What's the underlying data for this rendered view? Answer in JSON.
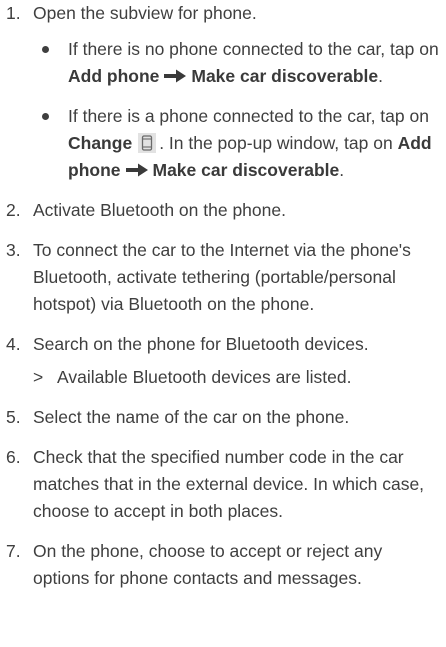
{
  "steps": [
    {
      "num": "1.",
      "text": "Open the subview for phone."
    },
    {
      "num": "2.",
      "text": "Activate Bluetooth on the phone."
    },
    {
      "num": "3.",
      "text": "To connect the car to the Internet via the phone's Bluetooth, activate tethering (portable/personal hotspot) via Bluetooth on the phone."
    },
    {
      "num": "4.",
      "text": "Search on the phone for Bluetooth devices.",
      "result_marker": ">",
      "result": "Available Bluetooth devices are listed."
    },
    {
      "num": "5.",
      "text": "Select the name of the car on the phone."
    },
    {
      "num": "6.",
      "text": "Check that the specified number code in the car matches that in the external device. In which case, choose to accept in both places."
    },
    {
      "num": "7.",
      "text": "On the phone, choose to accept or reject any options for phone contacts and messages."
    }
  ],
  "bullets": [
    {
      "pre": "If there is no phone connected to the car, tap on ",
      "bold1": "Add phone",
      "bold2": "Make car discoverable",
      "post": "."
    },
    {
      "pre": "If there is a phone connected to the car, tap on ",
      "change": "Change",
      "mid": ". In the pop-up window, tap on ",
      "bold1": "Add phone",
      "bold2": "Make car discoverable",
      "post": "."
    }
  ],
  "icons": {
    "arrow": "right-arrow-icon",
    "change": "phone-change-icon"
  }
}
